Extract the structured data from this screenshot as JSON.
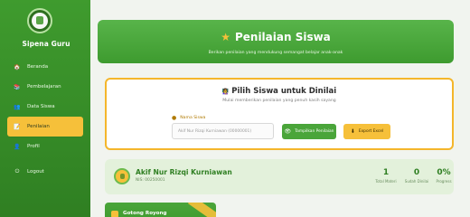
{
  "sidebar": {
    "brand": "Sipena Guru",
    "items": [
      {
        "label": "Beranda",
        "icon": "home-icon",
        "glyph": "🏠"
      },
      {
        "label": "Pembelajaran",
        "icon": "book-icon",
        "glyph": "📚"
      },
      {
        "label": "Data Siswa",
        "icon": "users-icon",
        "glyph": "👥"
      },
      {
        "label": "Penilaian",
        "icon": "clipboard-icon",
        "glyph": "📝",
        "active": true
      },
      {
        "label": "Profil",
        "icon": "user-icon",
        "glyph": "👤"
      },
      {
        "label": "Logout",
        "icon": "logout-icon",
        "glyph": "⏻"
      }
    ]
  },
  "hero": {
    "title": "Penilaian Siswa",
    "subtitle": "Berikan penilaian yang mendukung semangat belajar anak-anak"
  },
  "select_student": {
    "title": "Pilih Siswa untuk Dinilai",
    "subtitle": "Mulai memberikan penilaian yang penuh kasih sayang",
    "label": "Nama Siswa",
    "input_value": "Akif Nur Rizqi Kurniawan (00000001)",
    "show_button": "Tampilkan Penilaian",
    "export_button": "Export Excel"
  },
  "student_summary": {
    "name": "Akif Nur Rizqi Kurniawan",
    "nis": "NIS: 00250001",
    "stats": [
      {
        "value": "1",
        "label": "Total Materi"
      },
      {
        "value": "0",
        "label": "Sudah Dinilai"
      },
      {
        "value": "0%",
        "label": "Progress"
      }
    ]
  },
  "aspect": {
    "title": "Gotong Royong"
  },
  "colors": {
    "green": "#3f9b2e",
    "yellow": "#f6c03a",
    "bg": "#f1f4ef"
  }
}
